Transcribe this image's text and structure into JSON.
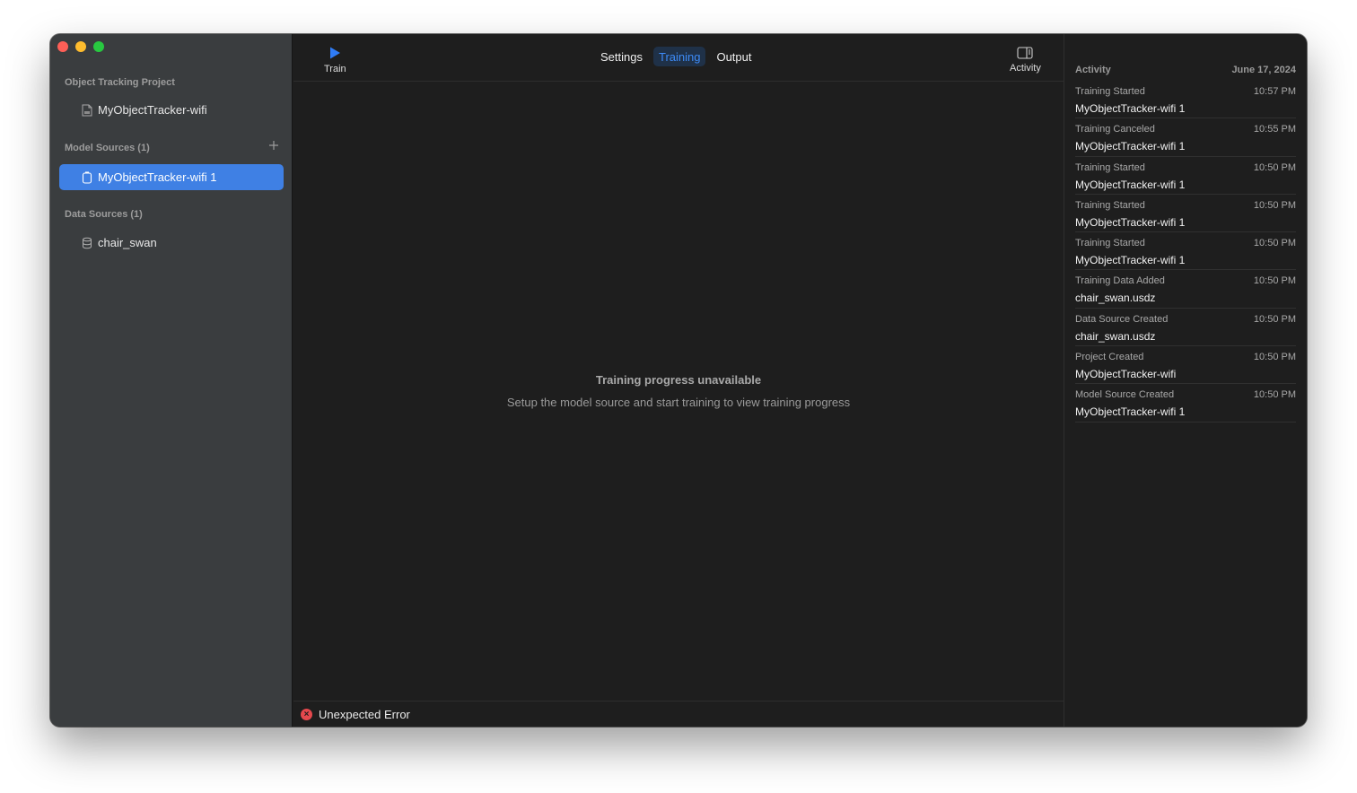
{
  "sidebar": {
    "project_header": "Object Tracking Project",
    "project_item": "MyObjectTracker-wifi",
    "model_sources_header": "Model Sources (1)",
    "model_source_item": "MyObjectTracker-wifi 1",
    "data_sources_header": "Data Sources (1)",
    "data_source_item": "chair_swan"
  },
  "toolbar": {
    "train_label": "Train",
    "tabs": [
      "Settings",
      "Training",
      "Output"
    ],
    "active_tab": "Training",
    "activity_label": "Activity"
  },
  "main": {
    "empty_title": "Training progress unavailable",
    "empty_subtitle": "Setup the model source and start training to view training progress"
  },
  "status": {
    "error_text": "Unexpected Error"
  },
  "activity": {
    "title": "Activity",
    "date": "June 17, 2024",
    "events": [
      {
        "event": "Training Started",
        "time": "10:57 PM",
        "target": "MyObjectTracker-wifi 1"
      },
      {
        "event": "Training Canceled",
        "time": "10:55 PM",
        "target": "MyObjectTracker-wifi 1"
      },
      {
        "event": "Training Started",
        "time": "10:50 PM",
        "target": "MyObjectTracker-wifi 1"
      },
      {
        "event": "Training Started",
        "time": "10:50 PM",
        "target": "MyObjectTracker-wifi 1"
      },
      {
        "event": "Training Started",
        "time": "10:50 PM",
        "target": "MyObjectTracker-wifi 1"
      },
      {
        "event": "Training Data Added",
        "time": "10:50 PM",
        "target": "chair_swan.usdz"
      },
      {
        "event": "Data Source Created",
        "time": "10:50 PM",
        "target": "chair_swan.usdz"
      },
      {
        "event": "Project Created",
        "time": "10:50 PM",
        "target": "MyObjectTracker-wifi"
      },
      {
        "event": "Model Source Created",
        "time": "10:50 PM",
        "target": "MyObjectTracker-wifi 1"
      }
    ]
  },
  "colors": {
    "accent": "#3f80e4",
    "active_tab_text": "#3d8bf7",
    "error": "#e5484d"
  },
  "icons": {
    "train": "play-icon",
    "activity": "sidebar-right-icon",
    "project": "document-icon",
    "model_source": "model-icon",
    "data_source": "database-icon",
    "error": "error-circle-icon",
    "add": "plus-icon"
  }
}
